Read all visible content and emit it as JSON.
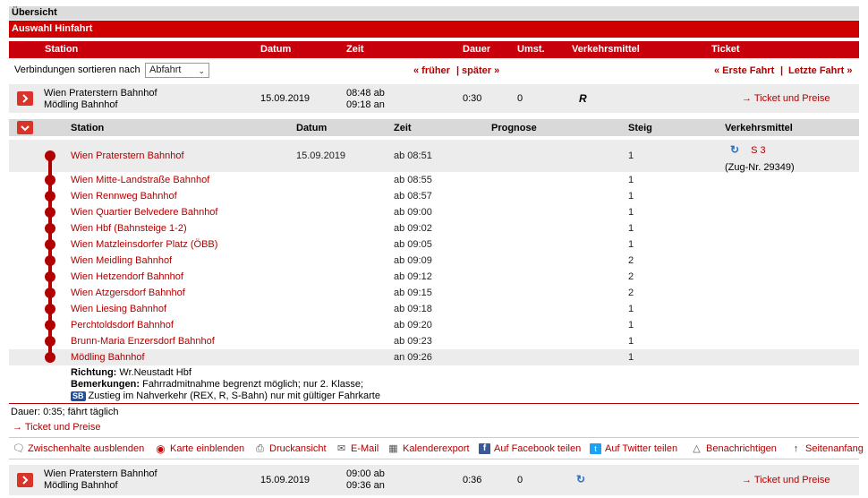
{
  "overview": {
    "title": "Übersicht"
  },
  "section": {
    "title": "Auswahl Hinfahrt"
  },
  "columns": {
    "station": "Station",
    "datum": "Datum",
    "zeit": "Zeit",
    "dauer": "Dauer",
    "umst": "Umst.",
    "verkehrsmittel": "Verkehrsmittel",
    "ticket": "Ticket"
  },
  "sort": {
    "label": "Verbindungen sortieren nach",
    "selected": "Abfahrt",
    "earlier": "« früher",
    "sep": "|",
    "later": "später »",
    "first": "« Erste Fahrt",
    "sep2": "|",
    "last": "Letzte Fahrt »"
  },
  "connection1": {
    "from": "Wien Praterstern Bahnhof",
    "to": "Mödling Bahnhof",
    "date": "15.09.2019",
    "dep": "08:48 ab",
    "arr": "09:18 an",
    "duration": "0:30",
    "changes": "0",
    "transport": "R",
    "ticket": "Ticket und Preise"
  },
  "detail_columns": {
    "station": "Station",
    "datum": "Datum",
    "zeit": "Zeit",
    "prognose": "Prognose",
    "steig": "Steig",
    "verkehrsmittel": "Verkehrsmittel"
  },
  "stops": [
    {
      "name": "Wien Praterstern Bahnhof",
      "date": "15.09.2019",
      "time": "ab 08:51",
      "platform": "1"
    },
    {
      "name": "Wien Mitte-Landstraße Bahnhof",
      "date": "",
      "time": "ab 08:55",
      "platform": "1"
    },
    {
      "name": "Wien Rennweg Bahnhof",
      "date": "",
      "time": "ab 08:57",
      "platform": "1"
    },
    {
      "name": "Wien Quartier Belvedere Bahnhof",
      "date": "",
      "time": "ab 09:00",
      "platform": "1"
    },
    {
      "name": "Wien Hbf (Bahnsteige 1-2)",
      "date": "",
      "time": "ab 09:02",
      "platform": "1"
    },
    {
      "name": "Wien Matzleinsdorfer Platz (ÖBB)",
      "date": "",
      "time": "ab 09:05",
      "platform": "1"
    },
    {
      "name": "Wien Meidling Bahnhof",
      "date": "",
      "time": "ab 09:09",
      "platform": "2"
    },
    {
      "name": "Wien Hetzendorf Bahnhof",
      "date": "",
      "time": "ab 09:12",
      "platform": "2"
    },
    {
      "name": "Wien Atzgersdorf Bahnhof",
      "date": "",
      "time": "ab 09:15",
      "platform": "2"
    },
    {
      "name": "Wien Liesing Bahnhof",
      "date": "",
      "time": "ab 09:18",
      "platform": "1"
    },
    {
      "name": "Perchtoldsdorf Bahnhof",
      "date": "",
      "time": "ab 09:20",
      "platform": "1"
    },
    {
      "name": "Brunn-Maria Enzersdorf Bahnhof",
      "date": "",
      "time": "ab 09:23",
      "platform": "1"
    },
    {
      "name": "Mödling Bahnhof",
      "date": "",
      "time": "an 09:26",
      "platform": "1"
    }
  ],
  "train": {
    "line": "S 3",
    "number": "(Zug-Nr. 29349)"
  },
  "remarks": {
    "direction_label": "Richtung:",
    "direction": "Wr.Neustadt Hbf",
    "remarks_label": "Bemerkungen:",
    "remarks": "Fahrradmitnahme begrenzt möglich; nur 2. Klasse;",
    "sb_badge": "SB",
    "boarding": "Zustieg im Nahverkehr (REX, R, S-Bahn) nur mit gültiger Fahrkarte"
  },
  "summary": {
    "duration": "Dauer: 0:35; fährt täglich",
    "ticket": "Ticket und Preise"
  },
  "toolbar": {
    "hide_stops": "Zwischenhalte ausblenden",
    "show_map": "Karte einblenden",
    "print": "Druckansicht",
    "email": "E-Mail",
    "calendar": "Kalenderexport",
    "facebook": "Auf Facebook teilen",
    "twitter": "Auf Twitter teilen",
    "notify": "Benachrichtigen",
    "top": "Seitenanfang"
  },
  "connection2": {
    "from": "Wien Praterstern Bahnhof",
    "to": "Mödling Bahnhof",
    "date": "15.09.2019",
    "dep": "09:00 ab",
    "arr": "09:36 an",
    "duration": "0:36",
    "changes": "0",
    "ticket": "Ticket und Preise"
  },
  "colors": {
    "brand_red": "#c8000c",
    "link_red": "#b00000",
    "sbahn_blue": "#2a6fc0"
  }
}
